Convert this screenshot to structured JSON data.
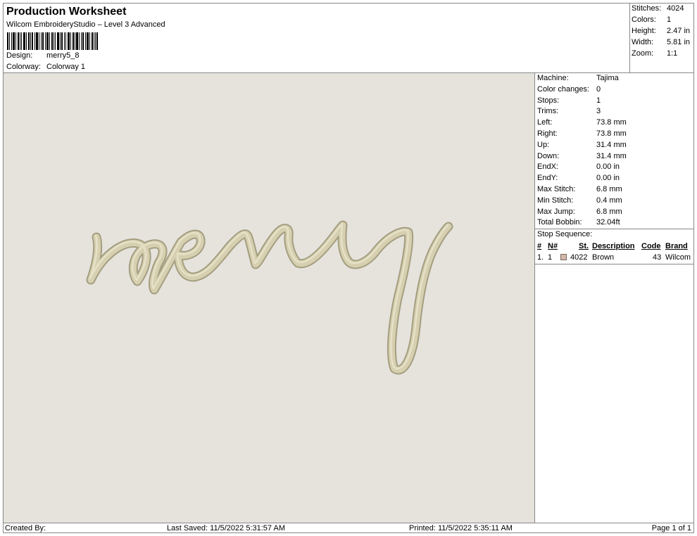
{
  "header": {
    "title": "Production Worksheet",
    "subtitle": "Wilcom EmbroideryStudio – Level 3 Advanced",
    "design_label": "Design:",
    "design_value": "merry5_8",
    "colorway_label": "Colorway:",
    "colorway_value": "Colorway 1"
  },
  "stats": [
    {
      "label": "Stitches:",
      "value": "4024"
    },
    {
      "label": "Colors:",
      "value": "1"
    },
    {
      "label": "Height:",
      "value": "2.47 in"
    },
    {
      "label": "Width:",
      "value": "5.81 in"
    },
    {
      "label": "Zoom:",
      "value": "1:1"
    }
  ],
  "properties": [
    {
      "label": "Machine:",
      "value": "Tajima"
    },
    {
      "label": "Color changes:",
      "value": "0"
    },
    {
      "label": "Stops:",
      "value": "1"
    },
    {
      "label": "Trims:",
      "value": "3"
    },
    {
      "label": "Left:",
      "value": "73.8 mm"
    },
    {
      "label": "Right:",
      "value": "73.8 mm"
    },
    {
      "label": "Up:",
      "value": "31.4 mm"
    },
    {
      "label": "Down:",
      "value": "31.4 mm"
    },
    {
      "label": "EndX:",
      "value": "0.00 in"
    },
    {
      "label": "EndY:",
      "value": "0.00 in"
    },
    {
      "label": "Max Stitch:",
      "value": "6.8 mm"
    },
    {
      "label": "Min Stitch:",
      "value": "0.4 mm"
    },
    {
      "label": "Max Jump:",
      "value": "6.8 mm"
    },
    {
      "label": "Total Bobbin:",
      "value": "32.04ft"
    }
  ],
  "stop_sequence": {
    "title": "Stop Sequence:",
    "headers": {
      "num": "#",
      "n": "N#",
      "st": "St.",
      "description": "Description",
      "code": "Code",
      "brand": "Brand"
    },
    "rows": [
      {
        "num": "1.",
        "n": "1",
        "st": "4022",
        "description": "Brown",
        "code": "43",
        "brand": "Wilcom",
        "color": "#d2b8a8"
      }
    ]
  },
  "design": {
    "thread_color": "#d6cfb0",
    "background": "#e6e3dd"
  },
  "footer": {
    "created": "Created By:",
    "saved": "Last Saved: 11/5/2022 5:31:57 AM",
    "printed": "Printed: 11/5/2022 5:35:11 AM",
    "page": "Page 1 of 1"
  }
}
